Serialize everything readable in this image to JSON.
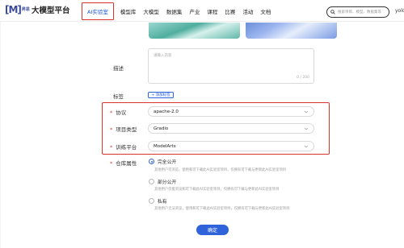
{
  "brand": {
    "logo_mark": "[M]",
    "logo_sub": "昇思",
    "title": "大模型平台"
  },
  "nav": {
    "items": [
      {
        "label": "AI实验室",
        "active": true
      },
      {
        "label": "模型库"
      },
      {
        "label": "大模型"
      },
      {
        "label": "数据集"
      },
      {
        "label": "产业"
      },
      {
        "label": "课程"
      },
      {
        "label": "比赛"
      },
      {
        "label": "活动"
      },
      {
        "label": "文档"
      }
    ]
  },
  "search": {
    "placeholder": "搜索项目、模型、数据集等"
  },
  "user": {
    "label": "yolo"
  },
  "form": {
    "description": {
      "label": "描述",
      "placeholder": "请输入内容",
      "counter": "0 / 200"
    },
    "tags": {
      "label": "标签",
      "add_button": "+ 添加标签"
    },
    "license": {
      "label": "协议",
      "value": "apache-2.0"
    },
    "project_type": {
      "label": "项目类型",
      "value": "Gradio"
    },
    "platform": {
      "label": "训练平台",
      "value": "ModelArts"
    },
    "visibility": {
      "label": "仓库属性",
      "options": [
        {
          "label": "完全公开",
          "desc": "其他用户可浏览、使用和可下载此AI实验室项目，仅拥有可下载与更新此AI实验室项目",
          "selected": true
        },
        {
          "label": "部分公开",
          "desc": "其他用户仅能浏览和可下载此AI实验室项目，仅拥有可下载与更新此AI实验室项目",
          "selected": false
        },
        {
          "label": "私有",
          "desc": "其他用户无法浏览，使用和可下载此AI实验室项目，仅拥有可下载与更新此AI实验室项目",
          "selected": false
        }
      ]
    },
    "submit": "确定"
  },
  "colors": {
    "accent": "#2f63d9",
    "highlight": "#d9342b",
    "required": "#e23b2f"
  }
}
